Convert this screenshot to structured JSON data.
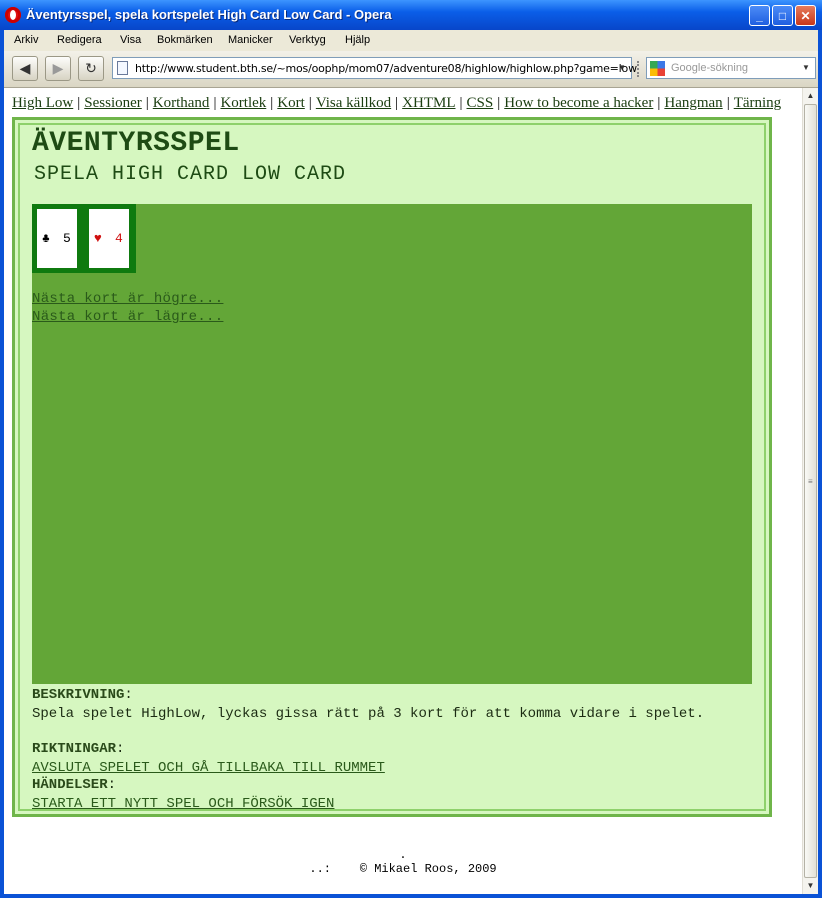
{
  "window": {
    "title": "Äventyrsspel, spela kortspelet High Card Low Card - Opera"
  },
  "menu": [
    "Arkiv",
    "Redigera",
    "Visa",
    "Bokmärken",
    "Manicker",
    "Verktyg",
    "Hjälp"
  ],
  "address": {
    "url": "http://www.student.bth.se/~mos/oophp/mom07/adventure08/highlow/highlow.php?game=low"
  },
  "search": {
    "placeholder": "Google-sökning"
  },
  "toplinks": [
    "High Low",
    "Sessioner",
    "Korthand",
    "Kortlek",
    "Kort",
    "Visa källkod",
    "XHTML",
    "CSS",
    "How to become a hacker",
    "Hangman",
    "Tärning"
  ],
  "page": {
    "heading": "ÄVENTYRSSPEL",
    "subheading": "SPELA HIGH CARD LOW CARD"
  },
  "cards": [
    {
      "suit": "♣",
      "rank": "5",
      "color": "#000000"
    },
    {
      "suit": "♥",
      "rank": "4",
      "color": "#d01010"
    }
  ],
  "game_links": {
    "higher": "Nästa kort är högre...",
    "lower": "Nästa kort är lägre..."
  },
  "description": {
    "label": "BESKRIVNING",
    "text": "Spela spelet HighLow, lyckas gissa rätt på 3 kort för att komma vidare i spelet."
  },
  "directions": {
    "label": "RIKTNINGAR",
    "link": "AVSLUTA SPELET OCH GÅ TILLBAKA TILL RUMMET"
  },
  "events": {
    "label": "HÄNDELSER",
    "link": "STARTA ETT NYTT SPEL OCH FÖRSÖK IGEN"
  },
  "footer": {
    "dots_top": ".",
    "dots_prefix": "..:",
    "copyright": "© Mikael Roos, 2009"
  },
  "colors": {
    "title_bar": "#0a5ee8",
    "panel_bg": "#d6f7c0",
    "table_green": "#63a637",
    "card_back": "#0f7a0f"
  }
}
